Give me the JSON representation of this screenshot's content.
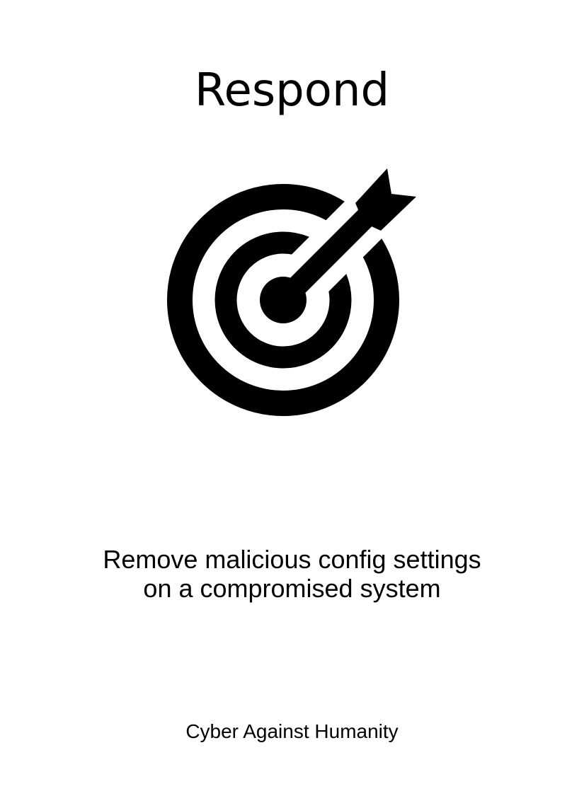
{
  "card": {
    "title": "Respond",
    "icon": "target-with-arrow-icon",
    "description_lines": [
      "Remove malicious config settings",
      "on a compromised system"
    ],
    "footer": "Cyber Against Humanity"
  },
  "colors": {
    "background": "#ffffff",
    "foreground": "#000000"
  }
}
